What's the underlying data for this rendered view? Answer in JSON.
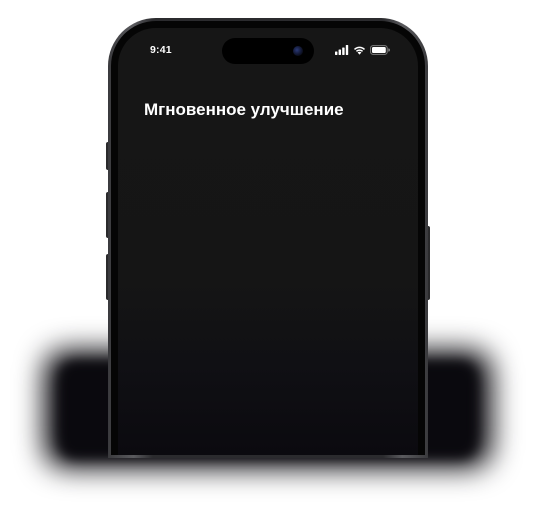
{
  "status_bar": {
    "time": "9:41",
    "icons": [
      "cellular-signal-icon",
      "wifi-icon",
      "battery-icon"
    ]
  },
  "screen": {
    "title": "Мгновенное улучшение"
  },
  "colors": {
    "screen_background": "#151515",
    "text": "#ffffff",
    "shadow": "#0b0a0f"
  }
}
